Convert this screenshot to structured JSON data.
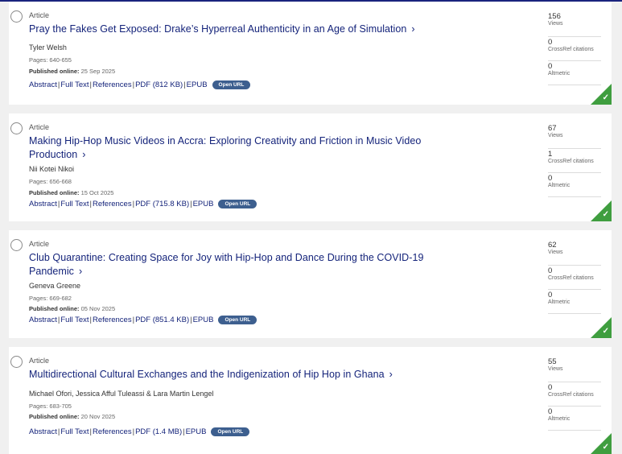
{
  "articles": [
    {
      "type": "Article",
      "title": "Pray the Fakes Get Exposed: Drake’s Hyperreal Authenticity in an Age of Simulation",
      "authors": "Tyler Welsh",
      "pages": "Pages: 640-655",
      "published_label": "Published online:",
      "published_date": "25 Sep 2025",
      "links": {
        "abstract": "Abstract",
        "fulltext": "Full Text",
        "references": "References",
        "pdf": "PDF (812 KB)",
        "epub": "EPUB"
      },
      "open_url": "Open URL",
      "metrics": [
        {
          "value": "156",
          "label": "Views"
        },
        {
          "value": "0",
          "label": "CrossRef citations"
        },
        {
          "value": "0",
          "label": "Altmetric"
        }
      ]
    },
    {
      "type": "Article",
      "title": "Making Hip-Hop Music Videos in Accra: Exploring Creativity and Friction in Music Video Production",
      "authors": "Nii Kotei Nikoi",
      "pages": "Pages: 656-668",
      "published_label": "Published online:",
      "published_date": "15 Oct 2025",
      "links": {
        "abstract": "Abstract",
        "fulltext": "Full Text",
        "references": "References",
        "pdf": "PDF (715.8 KB)",
        "epub": "EPUB"
      },
      "open_url": "Open URL",
      "metrics": [
        {
          "value": "67",
          "label": "Views"
        },
        {
          "value": "1",
          "label": "CrossRef citations"
        },
        {
          "value": "0",
          "label": "Altmetric"
        }
      ]
    },
    {
      "type": "Article",
      "title": "Club Quarantine: Creating Space for Joy with Hip-Hop and Dance During the COVID-19 Pandemic",
      "authors": "Geneva Greene",
      "pages": "Pages: 669-682",
      "published_label": "Published online:",
      "published_date": "05 Nov 2025",
      "links": {
        "abstract": "Abstract",
        "fulltext": "Full Text",
        "references": "References",
        "pdf": "PDF (851.4 KB)",
        "epub": "EPUB"
      },
      "open_url": "Open URL",
      "metrics": [
        {
          "value": "62",
          "label": "Views"
        },
        {
          "value": "0",
          "label": "CrossRef citations"
        },
        {
          "value": "0",
          "label": "Altmetric"
        }
      ]
    },
    {
      "type": "Article",
      "title": "Multidirectional Cultural Exchanges and the Indigenization of Hip Hop in Ghana",
      "authors": "Michael Ofori, Jessica Afful Tuleassi & Lara Martin Lengel",
      "pages": "Pages: 683-705",
      "published_label": "Published online:",
      "published_date": "20 Nov 2025",
      "links": {
        "abstract": "Abstract",
        "fulltext": "Full Text",
        "references": "References",
        "pdf": "PDF (1.4 MB)",
        "epub": "EPUB"
      },
      "open_url": "Open URL",
      "metrics": [
        {
          "value": "55",
          "label": "Views"
        },
        {
          "value": "0",
          "label": "CrossRef citations"
        },
        {
          "value": "0",
          "label": "Altmetric"
        }
      ]
    }
  ],
  "icons": {
    "select": "radio-circle-icon",
    "chevron": "chevron-right-icon",
    "access": "checkmark-icon"
  },
  "colors": {
    "title": "#14237a",
    "open_url_badge": "#3d5f8f",
    "access_corner": "#3f9e3f"
  }
}
